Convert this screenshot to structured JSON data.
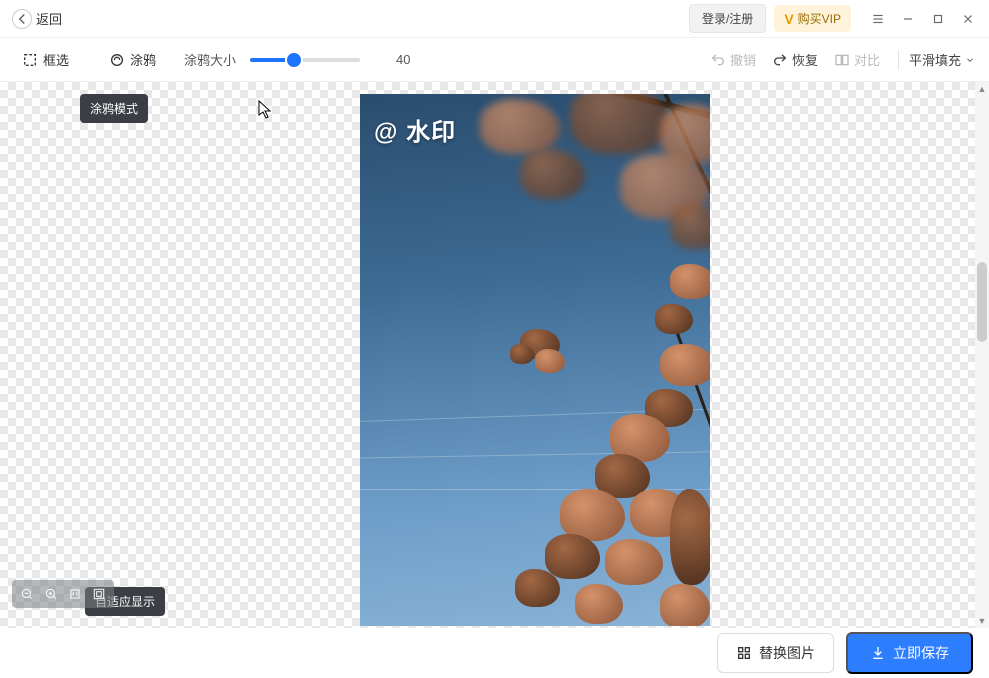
{
  "titlebar": {
    "back_label": "返回",
    "login_label": "登录/注册",
    "vip_label": "购买VIP"
  },
  "toolbar": {
    "box_select_label": "框选",
    "brush_label": "涂鸦",
    "brush_size_label": "涂鸦大小",
    "brush_size_value": "40",
    "undo_label": "撤销",
    "redo_label": "恢复",
    "compare_label": "对比",
    "fill_mode_label": "平滑填充"
  },
  "tooltips": {
    "brush_mode": "涂鸦模式",
    "fit_display": "自适应显示"
  },
  "canvas": {
    "watermark_text": "@ 水印"
  },
  "bottombar": {
    "replace_label": "替换图片",
    "save_label": "立即保存"
  }
}
